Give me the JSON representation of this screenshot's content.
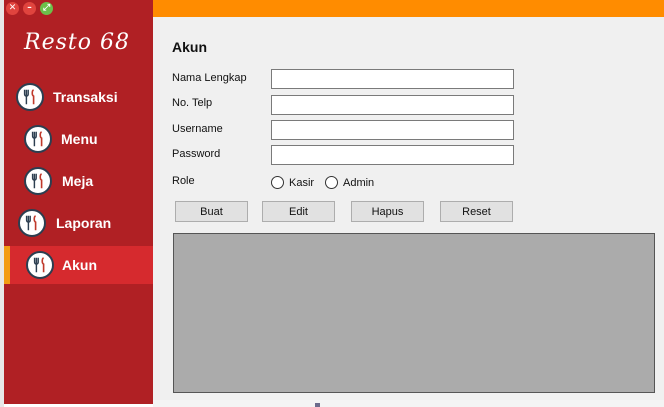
{
  "app": {
    "logo_text": "Resto 68"
  },
  "window_controls": {
    "close": "✕",
    "minimize": "–",
    "maximize": "⤢"
  },
  "sidebar": {
    "items": [
      {
        "label": "Transaksi",
        "icon": "utensils-icon",
        "active": false
      },
      {
        "label": "Menu",
        "icon": "utensils-icon",
        "active": false
      },
      {
        "label": "Meja",
        "icon": "utensils-icon",
        "active": false
      },
      {
        "label": "Laporan",
        "icon": "utensils-icon",
        "active": false
      },
      {
        "label": "Akun",
        "icon": "utensils-icon",
        "active": true
      }
    ]
  },
  "form": {
    "title": "Akun",
    "fields": [
      {
        "label": "Nama Lengkap",
        "value": ""
      },
      {
        "label": "No. Telp",
        "value": ""
      },
      {
        "label": "Username",
        "value": ""
      },
      {
        "label": "Password",
        "value": ""
      }
    ],
    "role_label": "Role",
    "role_options": [
      "Kasir",
      "Admin"
    ],
    "buttons": [
      "Buat",
      "Edit",
      "Hapus",
      "Reset"
    ]
  },
  "colors": {
    "sidebar": "#b02024",
    "active_item": "#d62a2e",
    "accent": "#ff8c00",
    "grid": "#ababab"
  }
}
